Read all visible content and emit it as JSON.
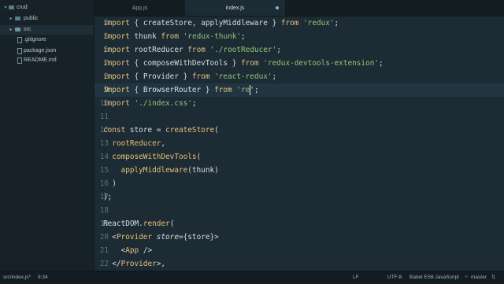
{
  "sidebar": {
    "items": [
      {
        "label": "crud",
        "type": "root",
        "arrow": "▾"
      },
      {
        "label": "public",
        "type": "folder",
        "arrow": "▸"
      },
      {
        "label": "src",
        "type": "folder-open",
        "arrow": "▸"
      },
      {
        "label": ".gitignore",
        "type": "file"
      },
      {
        "label": "package.json",
        "type": "file"
      },
      {
        "label": "README.md",
        "type": "file"
      }
    ]
  },
  "tabs": [
    {
      "label": "App.js",
      "active": false,
      "close": "×"
    },
    {
      "label": "index.js",
      "active": true
    }
  ],
  "editor": {
    "lines": [
      {
        "num": "4",
        "tokens": [
          [
            "kw",
            "import"
          ],
          [
            "pl",
            " { "
          ],
          [
            "id",
            "createStore, applyMiddleware"
          ],
          [
            "pl",
            " } "
          ],
          [
            "kw",
            "from"
          ],
          [
            "pl",
            " "
          ],
          [
            "str",
            "'redux'"
          ],
          [
            "pl",
            ";"
          ]
        ]
      },
      {
        "num": "5",
        "tokens": [
          [
            "kw",
            "import"
          ],
          [
            "pl",
            " "
          ],
          [
            "id",
            "thunk"
          ],
          [
            "pl",
            " "
          ],
          [
            "kw",
            "from"
          ],
          [
            "pl",
            " "
          ],
          [
            "str",
            "'redux-thunk'"
          ],
          [
            "pl",
            ";"
          ]
        ]
      },
      {
        "num": "6",
        "tokens": [
          [
            "kw",
            "import"
          ],
          [
            "pl",
            " "
          ],
          [
            "id",
            "rootReducer"
          ],
          [
            "pl",
            " "
          ],
          [
            "kw",
            "from"
          ],
          [
            "pl",
            " "
          ],
          [
            "str",
            "'./rootReducer'"
          ],
          [
            "pl",
            ";"
          ]
        ]
      },
      {
        "num": "7",
        "tokens": [
          [
            "kw",
            "import"
          ],
          [
            "pl",
            " { "
          ],
          [
            "id",
            "composeWithDevTools"
          ],
          [
            "pl",
            " } "
          ],
          [
            "kw",
            "from"
          ],
          [
            "pl",
            " "
          ],
          [
            "str",
            "'redux-devtools-extension'"
          ],
          [
            "pl",
            ";"
          ]
        ]
      },
      {
        "num": "8",
        "tokens": [
          [
            "kw",
            "import"
          ],
          [
            "pl",
            " { "
          ],
          [
            "id",
            "Provider"
          ],
          [
            "pl",
            " } "
          ],
          [
            "kw",
            "from"
          ],
          [
            "pl",
            " "
          ],
          [
            "str",
            "'react-redux'"
          ],
          [
            "pl",
            ";"
          ]
        ]
      },
      {
        "num": "9",
        "tokens": [
          [
            "kw",
            "import"
          ],
          [
            "pl",
            " { "
          ],
          [
            "id",
            "BrowserRouter"
          ],
          [
            "pl",
            " } "
          ],
          [
            "kw",
            "from"
          ],
          [
            "pl",
            " "
          ],
          [
            "str",
            "'re"
          ],
          [
            "pl",
            "'"
          ],
          [
            "pl",
            ";"
          ]
        ],
        "current": true
      },
      {
        "num": "10",
        "tokens": [
          [
            "kw",
            "import"
          ],
          [
            "pl",
            " "
          ],
          [
            "str",
            "'./index.css'"
          ],
          [
            "pl",
            ";"
          ]
        ]
      },
      {
        "num": "11",
        "tokens": []
      },
      {
        "num": "12",
        "tokens": [
          [
            "kw",
            "const"
          ],
          [
            "pl",
            " "
          ],
          [
            "id",
            "store"
          ],
          [
            "pl",
            " = "
          ],
          [
            "fn",
            "createStore"
          ],
          [
            "pl",
            "("
          ]
        ]
      },
      {
        "num": "13",
        "tokens": [
          [
            "pl",
            "  "
          ],
          [
            "fn",
            "rootReducer"
          ],
          [
            "pl",
            ","
          ]
        ]
      },
      {
        "num": "14",
        "tokens": [
          [
            "pl",
            "  "
          ],
          [
            "fn",
            "composeWithDevTools"
          ],
          [
            "pl",
            "("
          ]
        ]
      },
      {
        "num": "15",
        "tokens": [
          [
            "pl",
            "    "
          ],
          [
            "fn",
            "applyMiddleware"
          ],
          [
            "pl",
            "("
          ],
          [
            "id",
            "thunk"
          ],
          [
            "pl",
            ")"
          ]
        ]
      },
      {
        "num": "16",
        "tokens": [
          [
            "pl",
            "  )"
          ]
        ]
      },
      {
        "num": "17",
        "tokens": [
          [
            "pl",
            ");"
          ]
        ]
      },
      {
        "num": "18",
        "tokens": []
      },
      {
        "num": "19",
        "tokens": [
          [
            "id",
            "ReactDOM"
          ],
          [
            "pl",
            "."
          ],
          [
            "fn",
            "render"
          ],
          [
            "pl",
            "("
          ]
        ]
      },
      {
        "num": "20",
        "tokens": [
          [
            "pl",
            "  <"
          ],
          [
            "tag",
            "Provider"
          ],
          [
            "pl",
            " "
          ],
          [
            "attr",
            "store"
          ],
          [
            "pl",
            "={"
          ],
          [
            "id",
            "store"
          ],
          [
            "pl",
            "}>"
          ]
        ]
      },
      {
        "num": "21",
        "tokens": [
          [
            "pl",
            "    <"
          ],
          [
            "tag",
            "App"
          ],
          [
            "pl",
            " />"
          ]
        ]
      },
      {
        "num": "22",
        "tokens": [
          [
            "pl",
            "  </"
          ],
          [
            "tag",
            "Provider"
          ],
          [
            "pl",
            ">,"
          ]
        ]
      }
    ]
  },
  "statusbar": {
    "file": "src/index.js*",
    "position": "9:34",
    "line_ending": "LF",
    "encoding": "UTF-8",
    "grammar": "Babel ES6 JavaScript",
    "branch": "master"
  }
}
